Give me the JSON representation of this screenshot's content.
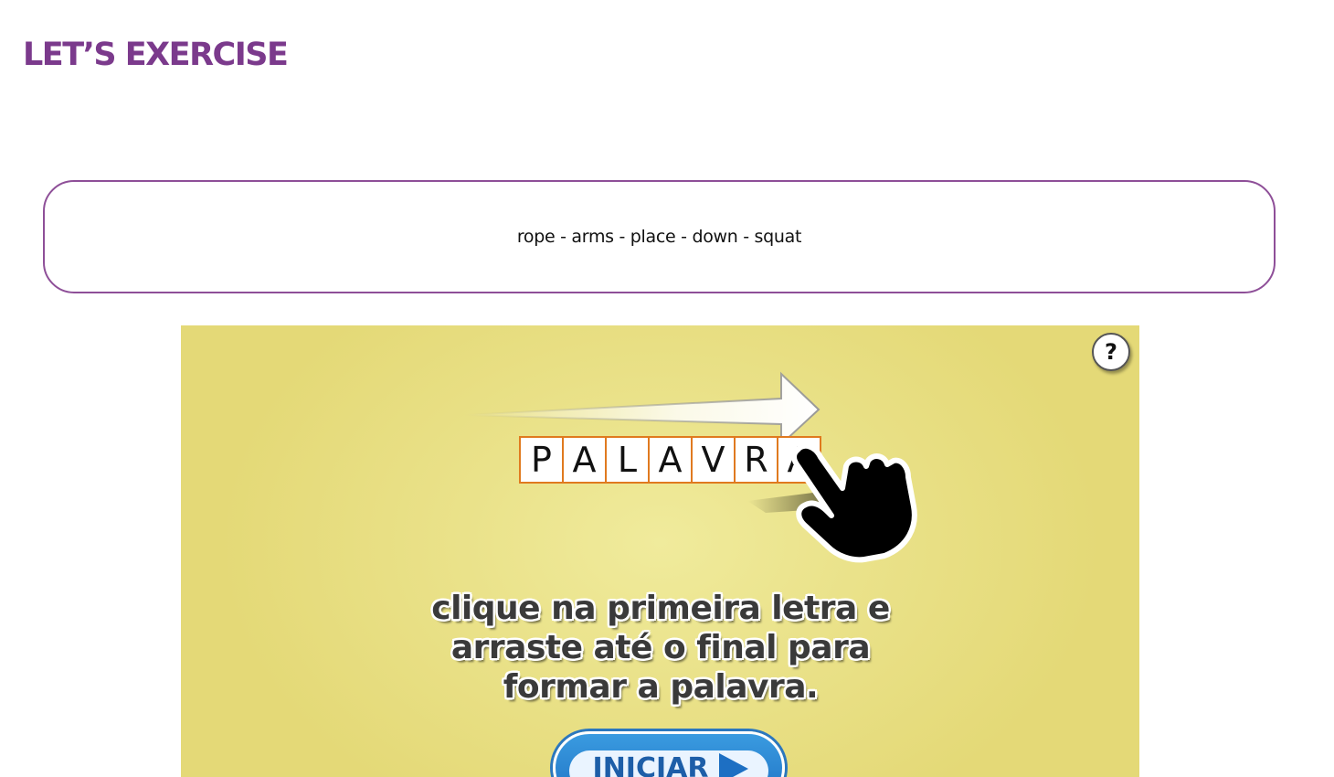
{
  "page": {
    "title": "LET’S EXERCISE"
  },
  "word_bank": {
    "text": "rope - arms - place - down - squat"
  },
  "game": {
    "help_label": "?",
    "demo_word": [
      "P",
      "A",
      "L",
      "A",
      "V",
      "R",
      "A"
    ],
    "instruction_lines": [
      "clique na primeira letra e",
      "arraste até o final para",
      "formar a palavra."
    ],
    "start_label": "INICIAR",
    "icons": {
      "help": "question-mark-icon",
      "drag_arrow": "arrow-right-icon",
      "hand": "pointing-hand-icon",
      "start": "play-triangle-icon"
    },
    "colors": {
      "background": "#e8df80",
      "letter_border": "#e07a1f",
      "button": "#2b86d6"
    }
  },
  "colors": {
    "brand": "#7b3a8c",
    "border": "#8e4f98"
  }
}
